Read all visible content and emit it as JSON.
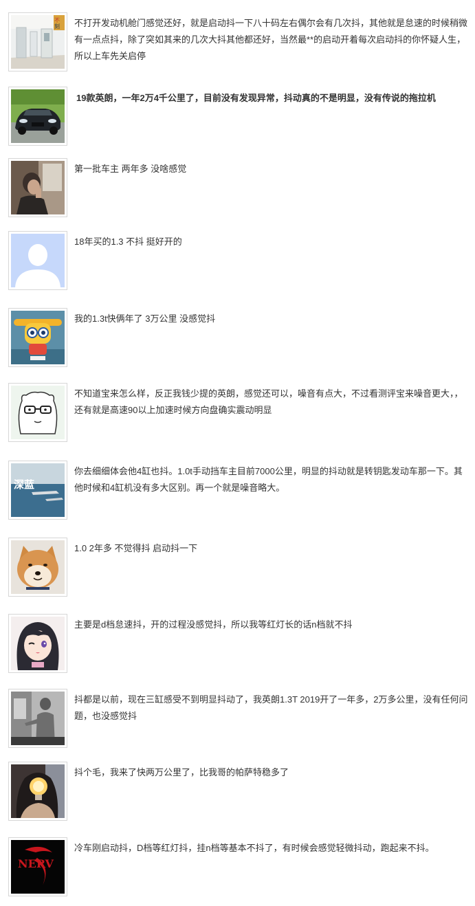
{
  "comments": [
    {
      "avatar": "room-photo-avatar",
      "text": "不打开发动机舱门感觉还好，就是启动抖一下八十码左右偶尔会有几次抖，其他就是怠速的时候稍微有一点点抖，除了突如其来的几次大抖其他都还好，当然最**的启动开着每次启动抖的你怀疑人生，所以上车先关启停"
    },
    {
      "avatar": "sports-car-avatar",
      "text": "19款英朗，一年2万4千公里了，目前没有发现异常，抖动真的不是明显，没有传说的拖拉机"
    },
    {
      "avatar": "man-in-car-avatar",
      "text": " 第一批车主 两年多 没啥感觉"
    },
    {
      "avatar": "default-user-avatar",
      "text": "18年买的1.3 不抖 挺好开的"
    },
    {
      "avatar": "cartoon-robot-avatar",
      "text": "我的1.3t快俩年了 3万公里 没感觉抖"
    },
    {
      "avatar": "cartoon-face-glasses-avatar",
      "text": "不知道宝来怎么样，反正我钱少提的英朗，感觉还可以，噪音有点大，不过看测评宝来噪音更大，，还有就是高速90以上加速时候方向盘确实震动明显"
    },
    {
      "avatar": "ocean-shenlan-avatar",
      "text": "你去细细体会他4缸也抖。1.0t手动挡车主目前7000公里，明显的抖动就是转钥匙发动车那一下。其他时候和4缸机没有多大区别。再一个就是噪音略大。",
      "avatar_label": "深蓝"
    },
    {
      "avatar": "shiba-dog-avatar",
      "text": "1.0 2年多 不觉得抖 启动抖一下"
    },
    {
      "avatar": "anime-girl-avatar",
      "text": "主要是d档怠速抖，开的过程没感觉抖，所以我等红灯长的话n档就不抖"
    },
    {
      "avatar": "grayscale-man-avatar",
      "text": "抖都是以前，现在三缸感受不到明显抖动了，我英朗1.3T 2019开了一年多，2万多公里，没有任何问题，也没感觉抖"
    },
    {
      "avatar": "lightbulb-person-avatar",
      "text": "抖个毛，我来了快两万公里了，比我哥的帕萨特稳多了"
    },
    {
      "avatar": "nerv-logo-avatar",
      "text": "冷车刚启动抖，D档等红灯抖，挂n档等基本不抖了，有时候会感觉轻微抖动，跑起来不抖。",
      "avatar_label": "NERV"
    }
  ],
  "colors": {
    "text": "#333333",
    "avatar_border": "#d6d6d6",
    "default_avatar_bg": "#c6d8fb"
  }
}
